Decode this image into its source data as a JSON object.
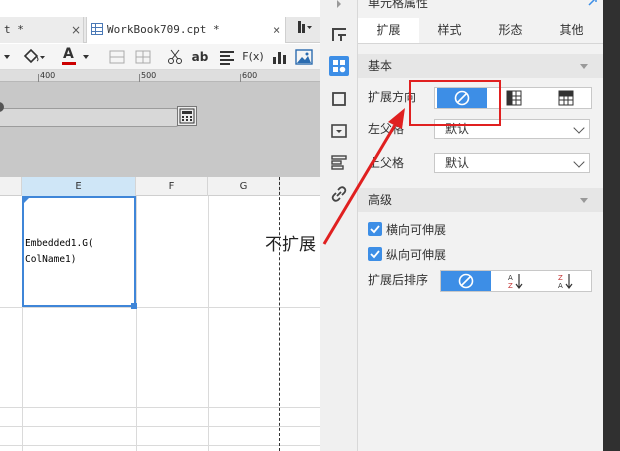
{
  "tabs": {
    "prev_label": "t *",
    "active_label": "WorkBook709.cpt *",
    "close_glyph": "×",
    "action_glyph": "▶"
  },
  "toolbar": {
    "paint_icon": "paint-bucket-icon",
    "font_color_glyph": "A",
    "font_color": "#cc0000",
    "text_tool_glyph": "ab",
    "formula_glyph": "F(x)"
  },
  "ruler": {
    "marks": [
      "400",
      "500",
      "600"
    ]
  },
  "grid": {
    "columns": [
      "E",
      "F",
      "G"
    ],
    "selected_column": "E",
    "cell_text": "Embedded1.G(\nColName1)"
  },
  "annotation": {
    "text": "不扩展"
  },
  "panel": {
    "title": "单元格属性",
    "tabs": [
      "扩展",
      "样式",
      "形态",
      "其他"
    ],
    "active_tab": "扩展",
    "basic": {
      "title": "基本",
      "expand_direction_label": "扩展方向",
      "expand_direction_options": [
        "no-expand-icon",
        "vertical-expand-icon",
        "horizontal-expand-icon"
      ],
      "expand_direction_selected": "no-expand-icon",
      "left_parent_label": "左父格",
      "left_parent_value": "默认",
      "top_parent_label": "上父格",
      "top_parent_value": "默认"
    },
    "advanced": {
      "title": "高级",
      "horizontal_stretch_label": "横向可伸展",
      "horizontal_stretch_checked": true,
      "vertical_stretch_label": "纵向可伸展",
      "vertical_stretch_checked": true,
      "sort_label": "扩展后排序",
      "sort_options": [
        "no-sort-icon",
        "sort-ascending-icon",
        "sort-descending-icon"
      ],
      "sort_selected": "no-sort-icon"
    }
  },
  "colors": {
    "accent": "#3d8ee6",
    "highlight": "#e02020",
    "selection": "#3f86d8"
  }
}
